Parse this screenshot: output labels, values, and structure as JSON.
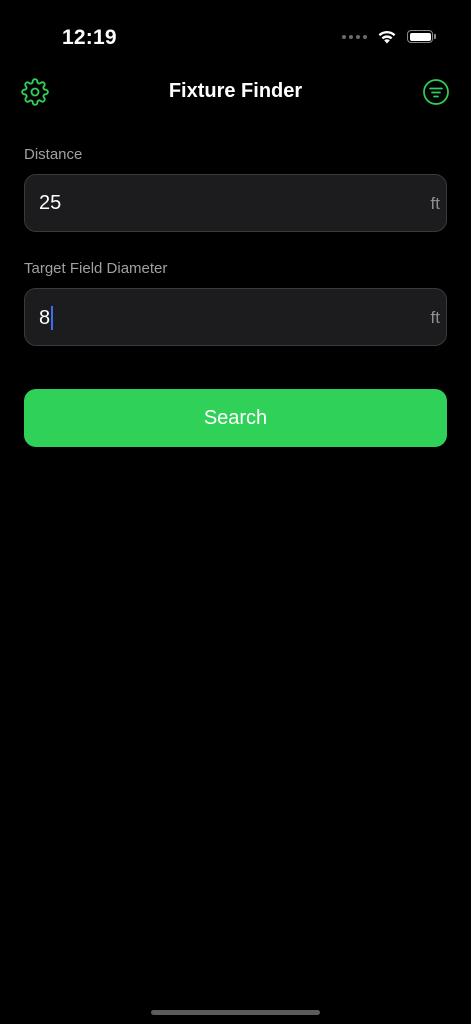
{
  "status_bar": {
    "time": "12:19",
    "signal_icon": "signal-dots-icon",
    "wifi_icon": "wifi-icon",
    "battery_icon": "battery-icon",
    "battery_level": 1.0
  },
  "nav": {
    "title": "Fixture Finder",
    "left_icon": "gear-icon",
    "right_icon": "filter-icon"
  },
  "form": {
    "distance": {
      "label": "Distance",
      "value": "25",
      "unit": "ft"
    },
    "diameter": {
      "label": "Target Field Diameter",
      "value": "8",
      "unit": "ft",
      "focused": true
    }
  },
  "search_button": {
    "label": "Search"
  },
  "colors": {
    "accent": "#30d158",
    "background": "#000000",
    "field_background": "#1c1c1e",
    "field_border": "#3a3a3c",
    "label_text": "#a0a0a5",
    "unit_text": "#8e8e93",
    "caret": "#3b6cf6"
  }
}
